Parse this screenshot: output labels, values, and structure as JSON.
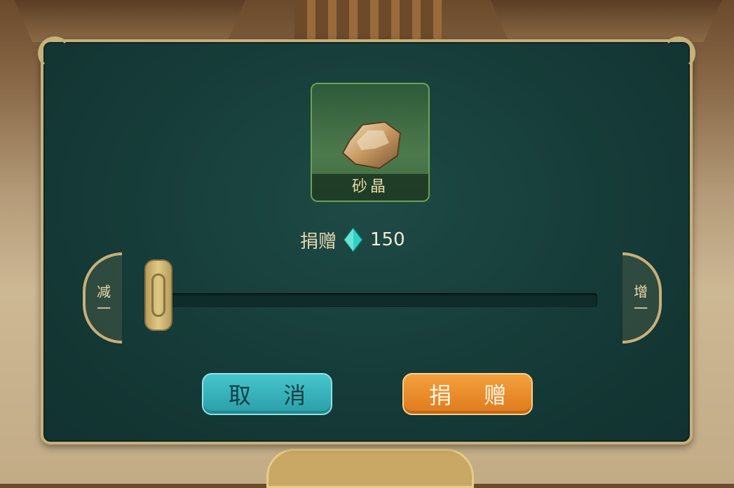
{
  "item": {
    "name": "砂晶",
    "icon": "stone-icon"
  },
  "cost": {
    "label": "捐赠",
    "icon": "diamond-gem-icon",
    "value": "150"
  },
  "slider": {
    "decrease_label": "减一",
    "increase_label": "增一",
    "level": 0
  },
  "buttons": {
    "cancel_label": "取 消",
    "donate_label": "捐 赠"
  },
  "colors": {
    "panel": "#153a37",
    "frame": "#c8b07a",
    "cancel": "#2a9ea8",
    "donate": "#e07a1c",
    "gem": "#2fd1c4"
  }
}
